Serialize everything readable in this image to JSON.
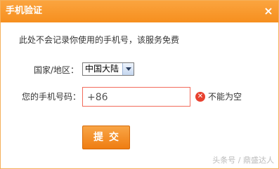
{
  "dialog": {
    "title": "手机验证",
    "close_glyph": "×",
    "colors": {
      "header": "#f79624",
      "accent": "#f08115",
      "error": "#e8412f"
    }
  },
  "form": {
    "notice": "此处不会记录你使用的手机号，该服务免费",
    "region_label": "国家/地区：",
    "region_value": "中国大陆",
    "phone_label": "您的手机号码：",
    "phone_value": "+86",
    "error_icon": "close-circle-icon",
    "error_glyph": "✕",
    "error_text": "不能为空",
    "submit_label": "提交"
  },
  "watermark": "头条号 / 鼎盛达人"
}
